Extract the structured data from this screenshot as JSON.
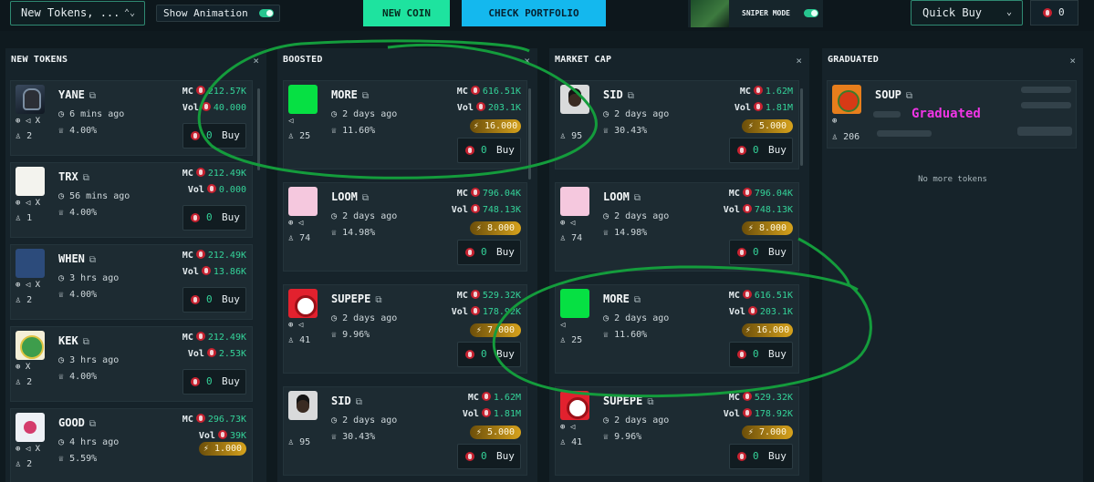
{
  "topbar": {
    "token_select": "New Tokens, ...",
    "animation_label": "Show Animation",
    "new_coin": "NEW COIN",
    "check_portfolio": "CHECK PORTFOLIO",
    "sniper_label": "SNIPER MODE",
    "quick_buy": "Quick Buy",
    "wallet_value": "0"
  },
  "columns": {
    "new": {
      "title": "NEW TOKENS",
      "tokens": [
        {
          "name": "YANE",
          "age": "6 mins ago",
          "pct": "4.00%",
          "holders": "2",
          "mc": "212.57K",
          "vol": "40.000",
          "socials": "⊕ ◁ X"
        },
        {
          "name": "TRX",
          "age": "56 mins ago",
          "pct": "4.00%",
          "holders": "1",
          "mc": "212.49K",
          "vol": "0.000",
          "socials": "⊕ ◁ X"
        },
        {
          "name": "WHEN",
          "age": "3 hrs ago",
          "pct": "4.00%",
          "holders": "2",
          "mc": "212.49K",
          "vol": "13.86K",
          "socials": "⊕ ◁ X"
        },
        {
          "name": "KEK",
          "age": "3 hrs ago",
          "pct": "4.00%",
          "holders": "2",
          "mc": "212.49K",
          "vol": "2.53K",
          "socials": "⊕ X"
        },
        {
          "name": "GOOD",
          "age": "4 hrs ago",
          "pct": "5.59%",
          "holders": "2",
          "mc": "296.73K",
          "vol": "39K",
          "boost": "1.000",
          "socials": "⊕ ◁ X"
        }
      ]
    },
    "boosted": {
      "title": "BOOSTED",
      "tokens": [
        {
          "name": "MORE",
          "age": "2 days ago",
          "pct": "11.60%",
          "holders": "25",
          "mc": "616.51K",
          "vol": "203.1K",
          "boost": "16.000",
          "socials": "◁"
        },
        {
          "name": "LOOM",
          "age": "2 days ago",
          "pct": "14.98%",
          "holders": "74",
          "mc": "796.04K",
          "vol": "748.13K",
          "boost": "8.000",
          "socials": "⊕ ◁"
        },
        {
          "name": "SUPEPE",
          "age": "2 days ago",
          "pct": "9.96%",
          "holders": "41",
          "mc": "529.32K",
          "vol": "178.92K",
          "boost": "7.000",
          "socials": "⊕ ◁"
        },
        {
          "name": "SID",
          "age": "2 days ago",
          "pct": "30.43%",
          "holders": "95",
          "mc": "1.62M",
          "vol": "1.81M",
          "boost": "5.000",
          "socials": ""
        }
      ]
    },
    "market": {
      "title": "MARKET CAP",
      "tokens": [
        {
          "name": "SID",
          "age": "2 days ago",
          "pct": "30.43%",
          "holders": "95",
          "mc": "1.62M",
          "vol": "1.81M",
          "boost": "5.000",
          "socials": ""
        },
        {
          "name": "LOOM",
          "age": "2 days ago",
          "pct": "14.98%",
          "holders": "74",
          "mc": "796.04K",
          "vol": "748.13K",
          "boost": "8.000",
          "socials": "⊕ ◁"
        },
        {
          "name": "MORE",
          "age": "2 days ago",
          "pct": "11.60%",
          "holders": "25",
          "mc": "616.51K",
          "vol": "203.1K",
          "boost": "16.000",
          "socials": "◁"
        },
        {
          "name": "SUPEPE",
          "age": "2 days ago",
          "pct": "9.96%",
          "holders": "41",
          "mc": "529.32K",
          "vol": "178.92K",
          "boost": "7.000",
          "socials": "⊕ ◁"
        }
      ]
    },
    "graduated": {
      "title": "GRADUATED",
      "token": {
        "name": "SOUP",
        "badge": "Graduated",
        "holders": "206",
        "socials": "⊕"
      },
      "empty_text": "No more tokens"
    }
  },
  "labels": {
    "mc": "MC",
    "vol": "Vol",
    "buy": "Buy",
    "buy_amount": "0",
    "close": "×",
    "copy": "⧉",
    "clock": "◷",
    "crown": "♕",
    "person": "♙",
    "bolt": "⚡"
  },
  "colors": {
    "accent_green": "#1ee39f",
    "accent_blue": "#14b8ee",
    "value_green": "#34d399",
    "graduated": "#f035e5",
    "annotation": "#149c3c"
  }
}
